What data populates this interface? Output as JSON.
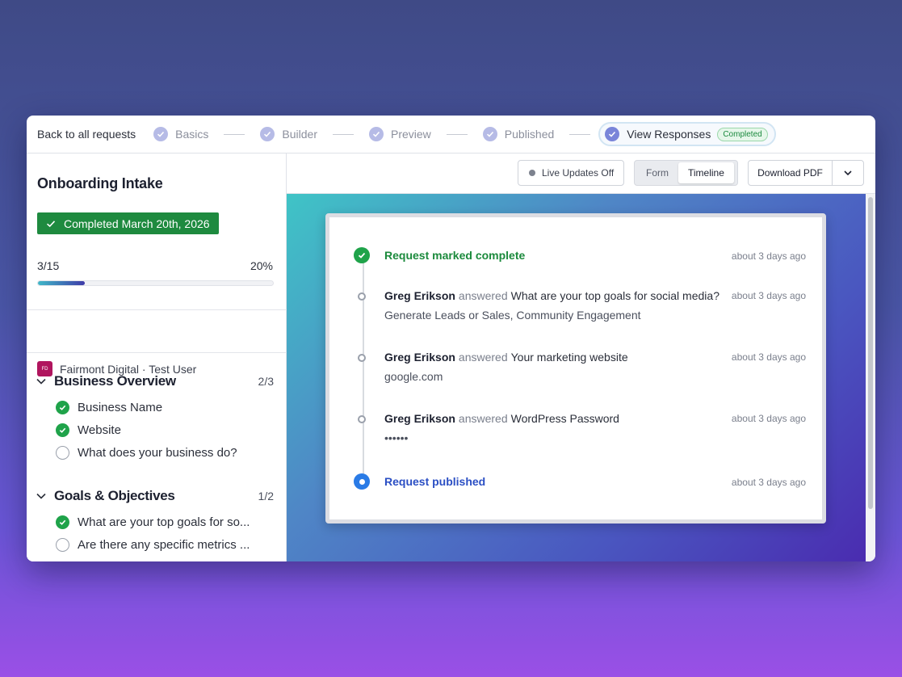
{
  "nav": {
    "back_label": "Back to all requests",
    "steps": [
      {
        "label": "Basics"
      },
      {
        "label": "Builder"
      },
      {
        "label": "Preview"
      },
      {
        "label": "Published"
      },
      {
        "label": "View Responses",
        "badge": "Completed"
      }
    ]
  },
  "sidebar": {
    "title": "Onboarding Intake",
    "completed_label": "Completed March 20th, 2026",
    "progress": {
      "count": "3/15",
      "percent_label": "20%",
      "fraction": 0.2
    },
    "org_avatar": "FD",
    "org_label": "Fairmont Digital · Test User",
    "sections": [
      {
        "title": "Business Overview",
        "count": "2/3",
        "items": [
          {
            "label": "Business Name",
            "done": true
          },
          {
            "label": "Website",
            "done": true
          },
          {
            "label": "What does your business do?",
            "done": false
          }
        ]
      },
      {
        "title": "Goals & Objectives",
        "count": "1/2",
        "items": [
          {
            "label": "What are your top goals for so...",
            "done": true
          },
          {
            "label": "Are there any specific metrics ...",
            "done": false
          }
        ]
      }
    ]
  },
  "toolbar": {
    "live_label": "Live Updates Off",
    "form_label": "Form",
    "timeline_label": "Timeline",
    "download_label": "Download PDF"
  },
  "timeline": [
    {
      "kind": "complete",
      "text": "Request marked complete",
      "time": "about 3 days ago"
    },
    {
      "kind": "answer",
      "who": "Greg Erikson",
      "verb": "answered",
      "question": "What are your top goals for social media?",
      "answer": "Generate Leads or Sales, Community Engagement",
      "time": "about 3 days ago"
    },
    {
      "kind": "answer",
      "who": "Greg Erikson",
      "verb": "answered",
      "question": "Your marketing website",
      "answer": "google.com",
      "time": "about 3 days ago"
    },
    {
      "kind": "answer",
      "who": "Greg Erikson",
      "verb": "answered",
      "question": "WordPress Password",
      "answer": "••••••",
      "time": "about 3 days ago"
    },
    {
      "kind": "published",
      "text": "Request published",
      "time": "about 3 days ago"
    }
  ],
  "colors": {
    "accent_green": "#1e8a3f",
    "accent_blue": "#2a7be6",
    "step_check": "#b6bbe6"
  }
}
